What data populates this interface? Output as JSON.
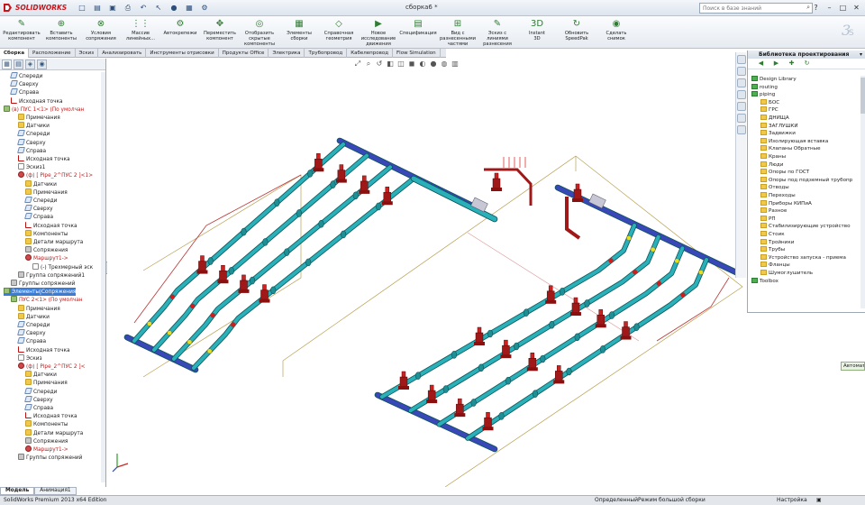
{
  "app": {
    "logo_text": "SOLIDWORKS",
    "document_title": "сборка6 *",
    "search_placeholder": "Поиск в базе знаний"
  },
  "quick_access": [
    "new-icon",
    "open-icon",
    "save-icon",
    "print-icon",
    "undo-icon",
    "select-icon",
    "rebuild-icon",
    "file-props-icon",
    "options-icon"
  ],
  "ribbon": [
    {
      "label": "Редактировать\nкомпонент",
      "icon": "edit-component-icon"
    },
    {
      "label": "Вставить\nкомпоненты",
      "icon": "insert-components-icon"
    },
    {
      "label": "Условия\nсопряжения",
      "icon": "mate-icon"
    },
    {
      "label": "Массив\nлинейных...",
      "icon": "linear-pattern-icon"
    },
    {
      "label": "Автокрепежи",
      "icon": "smart-fasteners-icon"
    },
    {
      "label": "Переместить\nкомпонент",
      "icon": "move-component-icon"
    },
    {
      "label": "Отобразить\nскрытые\nкомпоненты",
      "icon": "show-hidden-icon"
    },
    {
      "label": "Элементы\nсборки",
      "icon": "assembly-features-icon"
    },
    {
      "label": "Справочная\nгеометрия",
      "icon": "reference-geometry-icon"
    },
    {
      "label": "Новое\nисследование\nдвижения",
      "icon": "motion-study-icon"
    },
    {
      "label": "Спецификация",
      "icon": "bom-icon"
    },
    {
      "label": "Вид с\nразнесенными\nчастями",
      "icon": "exploded-view-icon"
    },
    {
      "label": "Эскиз с\nлиниями\nразнесения",
      "icon": "explode-line-sketch-icon"
    },
    {
      "label": "Instant\n3D",
      "icon": "instant3d-icon"
    },
    {
      "label": "Обновить\nSpeedPak",
      "icon": "speedpak-icon"
    },
    {
      "label": "Сделать\nснимок",
      "icon": "snapshot-icon"
    }
  ],
  "command_tabs": [
    "Сборка",
    "Расположение",
    "Эскиз",
    "Анализировать",
    "Инструменты отрисовки",
    "Продукты Office",
    "Электрика",
    "Трубопровод",
    "Кабелепровод",
    "Flow Simulation"
  ],
  "active_command_tab": 0,
  "tree": [
    {
      "label": "Спереди",
      "icon": "plane",
      "indent": 1
    },
    {
      "label": "Сверху",
      "icon": "plane",
      "indent": 1
    },
    {
      "label": "Справа",
      "icon": "plane",
      "indent": 1
    },
    {
      "label": "Исходная точка",
      "icon": "origin",
      "indent": 1
    },
    {
      "label": "(в) ПУС 1<1> (По умолчан",
      "icon": "asm",
      "indent": 0,
      "red": true
    },
    {
      "label": "Примечания",
      "icon": "folder",
      "indent": 2
    },
    {
      "label": "Датчики",
      "icon": "folder",
      "indent": 2
    },
    {
      "label": "Спереди",
      "icon": "plane",
      "indent": 2
    },
    {
      "label": "Сверху",
      "icon": "plane",
      "indent": 2
    },
    {
      "label": "Справа",
      "icon": "plane",
      "indent": 2
    },
    {
      "label": "Исходная точка",
      "icon": "origin",
      "indent": 2
    },
    {
      "label": "Эскиз1",
      "icon": "sketch",
      "indent": 2
    },
    {
      "label": "(ф) [ Pipe_2^ПУС 2 ]<1>",
      "icon": "route",
      "indent": 2,
      "red": true
    },
    {
      "label": "Датчики",
      "icon": "folder",
      "indent": 3
    },
    {
      "label": "Примечания",
      "icon": "folder",
      "indent": 3
    },
    {
      "label": "Спереди",
      "icon": "plane",
      "indent": 3
    },
    {
      "label": "Сверху",
      "icon": "plane",
      "indent": 3
    },
    {
      "label": "Справа",
      "icon": "plane",
      "indent": 3
    },
    {
      "label": "Исходная точка",
      "icon": "origin",
      "indent": 3
    },
    {
      "label": "Компоненты",
      "icon": "folder",
      "indent": 3
    },
    {
      "label": "Детали маршрута",
      "icon": "folder",
      "indent": 3
    },
    {
      "label": "Сопряжения",
      "icon": "mates",
      "indent": 3
    },
    {
      "label": "Маршрут1->",
      "icon": "route",
      "indent": 3,
      "red": true
    },
    {
      "label": "(-) Трехмерный эск",
      "icon": "sketch",
      "indent": 4
    },
    {
      "label": "Группа сопряжений1",
      "icon": "mates",
      "indent": 2
    },
    {
      "label": "Группы сопряжений",
      "icon": "mates",
      "indent": 1
    },
    {
      "label": "Элементы|Сопряжения",
      "icon": "asm",
      "indent": 0,
      "selected": true
    },
    {
      "label": "ПУС 2<1> (По умолчан",
      "icon": "asm",
      "indent": 1,
      "red": true
    },
    {
      "label": "Примечания",
      "icon": "folder",
      "indent": 2
    },
    {
      "label": "Датчики",
      "icon": "folder",
      "indent": 2
    },
    {
      "label": "Спереди",
      "icon": "plane",
      "indent": 2
    },
    {
      "label": "Сверху",
      "icon": "plane",
      "indent": 2
    },
    {
      "label": "Справа",
      "icon": "plane",
      "indent": 2
    },
    {
      "label": "Исходная точка",
      "icon": "origin",
      "indent": 2
    },
    {
      "label": "Эскиз",
      "icon": "sketch",
      "indent": 2
    },
    {
      "label": "(ф) [ Pipe_2^ПУС 2 ]<",
      "icon": "route",
      "indent": 2,
      "red": true
    },
    {
      "label": "Датчики",
      "icon": "folder",
      "indent": 3
    },
    {
      "label": "Примечания",
      "icon": "folder",
      "indent": 3
    },
    {
      "label": "Спереди",
      "icon": "plane",
      "indent": 3
    },
    {
      "label": "Сверху",
      "icon": "plane",
      "indent": 3
    },
    {
      "label": "Справа",
      "icon": "plane",
      "indent": 3
    },
    {
      "label": "Исходная точка",
      "icon": "origin",
      "indent": 3
    },
    {
      "label": "Компоненты",
      "icon": "folder",
      "indent": 3
    },
    {
      "label": "Детали маршрута",
      "icon": "folder",
      "indent": 3
    },
    {
      "label": "Сопряжения",
      "icon": "mates",
      "indent": 3
    },
    {
      "label": "Маршрут1->",
      "icon": "route",
      "indent": 3,
      "red": true
    },
    {
      "label": "Группы сопряжений",
      "icon": "mates",
      "indent": 2
    }
  ],
  "bottom_tabs": [
    "Модель",
    "Анимация1"
  ],
  "design_library": {
    "title": "Библиотека проектирования",
    "items": [
      {
        "label": "Design Library",
        "indent": 0,
        "type": "group"
      },
      {
        "label": "routing",
        "indent": 0,
        "type": "group"
      },
      {
        "label": "piping",
        "indent": 0,
        "type": "group"
      },
      {
        "label": "БОС",
        "indent": 1,
        "type": "folder"
      },
      {
        "label": "ГРС",
        "indent": 1,
        "type": "folder"
      },
      {
        "label": "ДНИЩА",
        "indent": 1,
        "type": "folder"
      },
      {
        "label": "ЗАГЛУШКИ",
        "indent": 1,
        "type": "folder"
      },
      {
        "label": "Задвижки",
        "indent": 1,
        "type": "folder"
      },
      {
        "label": "Изолирующая вставка",
        "indent": 1,
        "type": "folder"
      },
      {
        "label": "Клапаны Обратные",
        "indent": 1,
        "type": "folder"
      },
      {
        "label": "Краны",
        "indent": 1,
        "type": "folder"
      },
      {
        "label": "Люди",
        "indent": 1,
        "type": "folder"
      },
      {
        "label": "Опоры по ГОСТ",
        "indent": 1,
        "type": "folder"
      },
      {
        "label": "Опоры под подземный трубопр",
        "indent": 1,
        "type": "folder"
      },
      {
        "label": "Отводы",
        "indent": 1,
        "type": "folder"
      },
      {
        "label": "Переходы",
        "indent": 1,
        "type": "folder"
      },
      {
        "label": "Приборы КИПиА",
        "indent": 1,
        "type": "folder"
      },
      {
        "label": "Разное",
        "indent": 1,
        "type": "folder"
      },
      {
        "label": "РП",
        "indent": 1,
        "type": "folder"
      },
      {
        "label": "Стабилизирующие устройство",
        "indent": 1,
        "type": "folder"
      },
      {
        "label": "Стоик",
        "indent": 1,
        "type": "folder"
      },
      {
        "label": "Тройники",
        "indent": 1,
        "type": "folder"
      },
      {
        "label": "Трубы",
        "indent": 1,
        "type": "folder"
      },
      {
        "label": "Устройство запуска - приема",
        "indent": 1,
        "type": "folder"
      },
      {
        "label": "Фланцы",
        "indent": 1,
        "type": "folder"
      },
      {
        "label": "Шумоглушитель",
        "indent": 1,
        "type": "folder"
      },
      {
        "label": "Toolbox",
        "indent": 0,
        "type": "group"
      }
    ]
  },
  "palette_tab": "Автоматически",
  "status": {
    "edition": "SolidWorks Premium 2013 x64 Edition",
    "mode": "Определенный",
    "large_assembly": "Режим большой сборки",
    "settings": "Настройка"
  },
  "colors": {
    "pipe": "#2ab0b8",
    "valve": "#a01818",
    "header_pipe": "#3848b8",
    "accent_yellow": "#e4e020",
    "accent_red": "#d41a1a",
    "bounding_box": "#b8a050"
  }
}
